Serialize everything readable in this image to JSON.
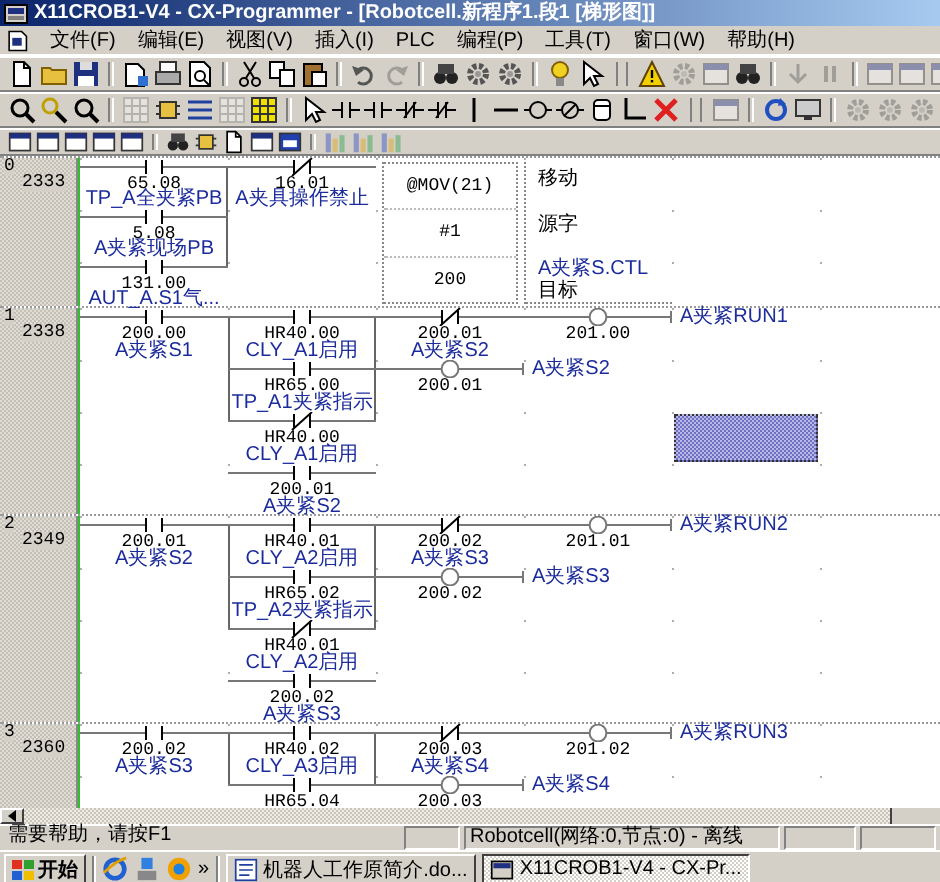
{
  "window": {
    "title": "X11CROB1-V4 - CX-Programmer - [Robotcell.新程序1.段1 [梯形图]]"
  },
  "menu": {
    "items": [
      "文件(F)",
      "编辑(E)",
      "视图(V)",
      "插入(I)",
      "PLC",
      "编程(P)",
      "工具(T)",
      "窗口(W)",
      "帮助(H)"
    ]
  },
  "ladder": {
    "rungs": [
      {
        "number": "0",
        "step": "2333",
        "rows": [
          [
            {
              "kind": "no",
              "address": "65.08",
              "comment": "TP_A全夹紧PB",
              "join_left": false,
              "join_right": false
            },
            {
              "kind": "nc",
              "address": "16.01",
              "comment": "A夹具操作禁止",
              "join_left": false,
              "join_right": false
            },
            {
              "kind": "instr",
              "mnemonic": "@MOV(21)",
              "description": "移动",
              "operands": [
                {
                  "value": "#1",
                  "label": "源字"
                },
                {
                  "value": "200",
                  "comment": "A夹紧S.CTL",
                  "label": "目标"
                }
              ]
            }
          ],
          [
            {
              "kind": "no",
              "address": "5.08",
              "comment": "A夹紧现场PB",
              "join_left": false,
              "join_right": true
            }
          ],
          [
            {
              "kind": "no",
              "address": "131.00",
              "comment": "AUT_A.S1气...",
              "join_left": false,
              "join_right": true
            }
          ]
        ]
      },
      {
        "number": "1",
        "step": "2338",
        "rows": [
          [
            {
              "kind": "no",
              "address": "200.00",
              "comment": "A夹紧S1",
              "join_left": false,
              "join_right": false
            },
            {
              "kind": "no",
              "address": "HR40.00",
              "comment": "CLY_A1启用",
              "join_left": false,
              "join_right": false
            },
            {
              "kind": "nc",
              "address": "200.01",
              "comment": "A夹紧S2",
              "join_left": false,
              "join_right": false
            },
            {
              "kind": "coil",
              "address": "201.00",
              "comment": "A夹紧RUN1"
            }
          ],
          [
            {
              "kind": "empty"
            },
            {
              "kind": "no",
              "address": "HR65.00",
              "comment": "TP_A1夹紧指示",
              "join_left": true,
              "join_right": true
            },
            {
              "kind": "coil",
              "address": "200.01",
              "comment": "A夹紧S2"
            }
          ],
          [
            {
              "kind": "empty"
            },
            {
              "kind": "nc",
              "address": "HR40.00",
              "comment": "CLY_A1启用",
              "join_left": true,
              "join_right": true
            },
            {
              "kind": "empty"
            },
            {
              "kind": "empty"
            },
            {
              "kind": "cursor"
            }
          ],
          [
            {
              "kind": "empty"
            },
            {
              "kind": "no",
              "address": "200.01",
              "comment": "A夹紧S2",
              "join_left": false,
              "join_right": false
            }
          ]
        ]
      },
      {
        "number": "2",
        "step": "2349",
        "rows": [
          [
            {
              "kind": "no",
              "address": "200.01",
              "comment": "A夹紧S2",
              "join_left": false,
              "join_right": false
            },
            {
              "kind": "no",
              "address": "HR40.01",
              "comment": "CLY_A2启用",
              "join_left": false,
              "join_right": false
            },
            {
              "kind": "nc",
              "address": "200.02",
              "comment": "A夹紧S3",
              "join_left": false,
              "join_right": false
            },
            {
              "kind": "coil",
              "address": "201.01",
              "comment": "A夹紧RUN2"
            }
          ],
          [
            {
              "kind": "empty"
            },
            {
              "kind": "no",
              "address": "HR65.02",
              "comment": "TP_A2夹紧指示",
              "join_left": true,
              "join_right": true
            },
            {
              "kind": "coil",
              "address": "200.02",
              "comment": "A夹紧S3"
            }
          ],
          [
            {
              "kind": "empty"
            },
            {
              "kind": "nc",
              "address": "HR40.01",
              "comment": "CLY_A2启用",
              "join_left": true,
              "join_right": true
            }
          ],
          [
            {
              "kind": "empty"
            },
            {
              "kind": "no",
              "address": "200.02",
              "comment": "A夹紧S3",
              "join_left": false,
              "join_right": false
            }
          ]
        ]
      },
      {
        "number": "3",
        "step": "2360",
        "rows": [
          [
            {
              "kind": "no",
              "address": "200.02",
              "comment": "A夹紧S3",
              "join_left": false,
              "join_right": false
            },
            {
              "kind": "no",
              "address": "HR40.02",
              "comment": "CLY_A3启用",
              "join_left": false,
              "join_right": false
            },
            {
              "kind": "nc",
              "address": "200.03",
              "comment": "A夹紧S4",
              "join_left": false,
              "join_right": false
            },
            {
              "kind": "coil",
              "address": "201.02",
              "comment": "A夹紧RUN3"
            }
          ],
          [
            {
              "kind": "empty"
            },
            {
              "kind": "no",
              "address": "HR65.04",
              "join_left": true,
              "join_right": true
            },
            {
              "kind": "coil",
              "address": "200.03",
              "comment": "A夹紧S4"
            }
          ]
        ]
      }
    ]
  },
  "status_bar": {
    "help": "需要帮助，请按F1",
    "connection": "Robotcell(网络:0,节点:0) - 离线"
  },
  "taskbar": {
    "start": "开始",
    "more": "»",
    "tasks": [
      {
        "label": "机器人工作原简介.do...",
        "selected": false
      },
      {
        "label": "X11CROB1-V4 - CX-Pr...",
        "selected": true
      }
    ]
  }
}
